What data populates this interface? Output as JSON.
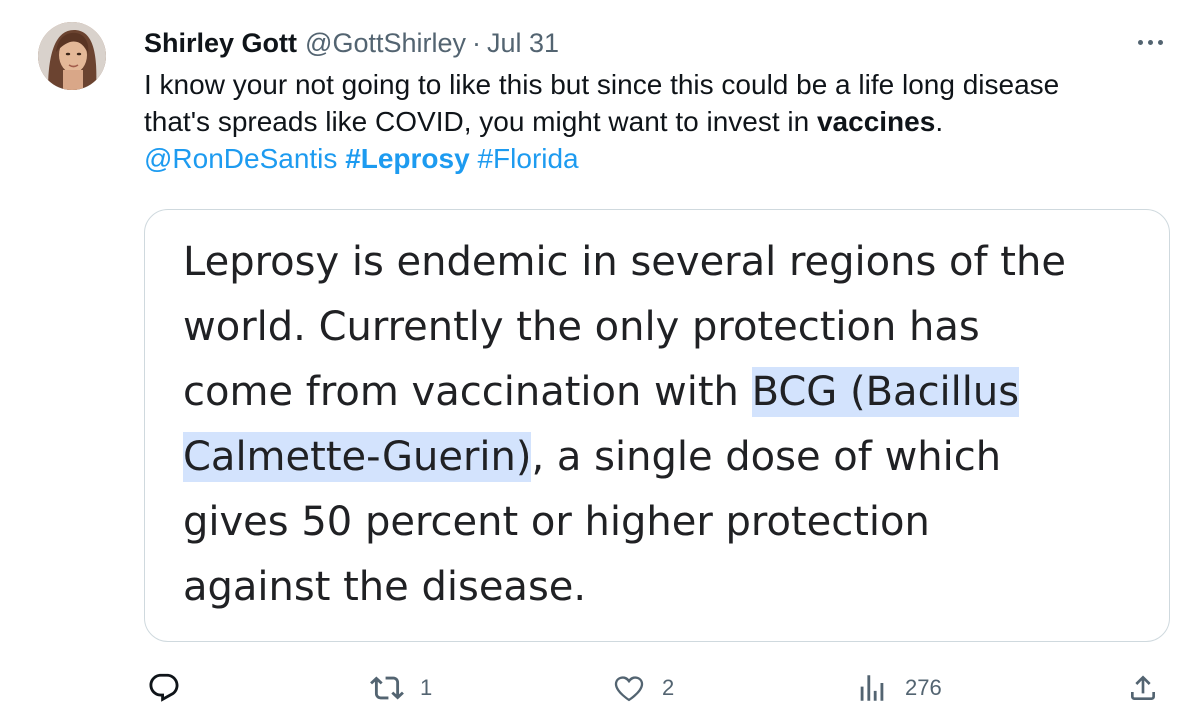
{
  "author": {
    "name": "Shirley Gott",
    "handle": "@GottShirley",
    "separator": "·",
    "date": "Jul 31"
  },
  "tweet": {
    "line1": "I know your not going to like this but since this could be a life long disease",
    "line2_pre": "that's spreads like COVID, you might want to invest in ",
    "line2_bold": "vaccines",
    "line2_post": ".",
    "mention": "@RonDeSantis",
    "hashtag1": "#Leprosy",
    "hashtag2": "#Florida"
  },
  "card": {
    "l1": "Leprosy is endemic in several regions of the",
    "l2": "world. Currently the only protection has",
    "l3_pre": "come from vaccination with ",
    "l3_hl": "BCG (Bacillus",
    "l4_hl": "Calmette-Guerin)",
    "l4_post": ", a single dose of which",
    "l5": "gives 50 percent or higher protection",
    "l6": "against the disease."
  },
  "actions": {
    "reply_count": "",
    "retweet_count": "1",
    "like_count": "2",
    "views_count": "276"
  },
  "icons": [
    "avatar",
    "more-icon",
    "reply-icon",
    "retweet-icon",
    "like-icon",
    "views-icon",
    "share-icon"
  ],
  "colors": {
    "link": "#1d9bf0",
    "muted": "#536471",
    "highlight": "#d3e3fd"
  }
}
